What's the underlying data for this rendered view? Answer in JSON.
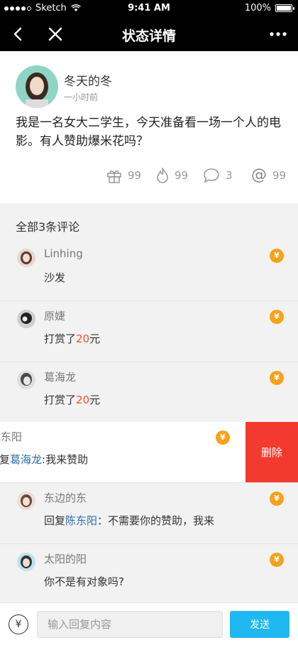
{
  "status_bar": {
    "carrier": "Sketch",
    "time": "9:41 AM",
    "battery": "100%"
  },
  "nav": {
    "title": "状态详情"
  },
  "post": {
    "author": "冬天的冬",
    "time": "一小时前",
    "content": "我是一名女大二学生，今天准备看一场一个人的电影。有人赞助爆米花吗？",
    "stats": {
      "gifts": "99",
      "hot": "99",
      "comments": "3",
      "mentions": "99"
    }
  },
  "comments_header": "全部3条评论",
  "comments": [
    {
      "name": "Linhing",
      "text": "沙发"
    },
    {
      "name": "原婕",
      "text_prefix": "打赏了",
      "amount": "20",
      "text_suffix": "元"
    },
    {
      "name": "葛海龙",
      "text_prefix": "打赏了",
      "amount": "20",
      "text_suffix": "元"
    },
    {
      "name": "陈东阳",
      "reply_prefix": "回复",
      "reply_to": "葛海龙",
      "text": ":我来赞助"
    },
    {
      "name": "东边的东",
      "reply_prefix": "回复",
      "reply_to": "陈东阳",
      "text": "：不需要你的赞助，我来"
    },
    {
      "name": "太阳的阳",
      "text": "你不是有对象吗?"
    }
  ],
  "coin_symbol": "¥",
  "delete_label": "删除",
  "reply_bar": {
    "placeholder": "输入回复内容",
    "send_label": "发送",
    "coin_symbol": "¥"
  },
  "colors": {
    "accent": "#1fb8f0",
    "coin": "#f7a21a",
    "delete": "#f23a2f",
    "highlight": "#ff4a2b"
  }
}
